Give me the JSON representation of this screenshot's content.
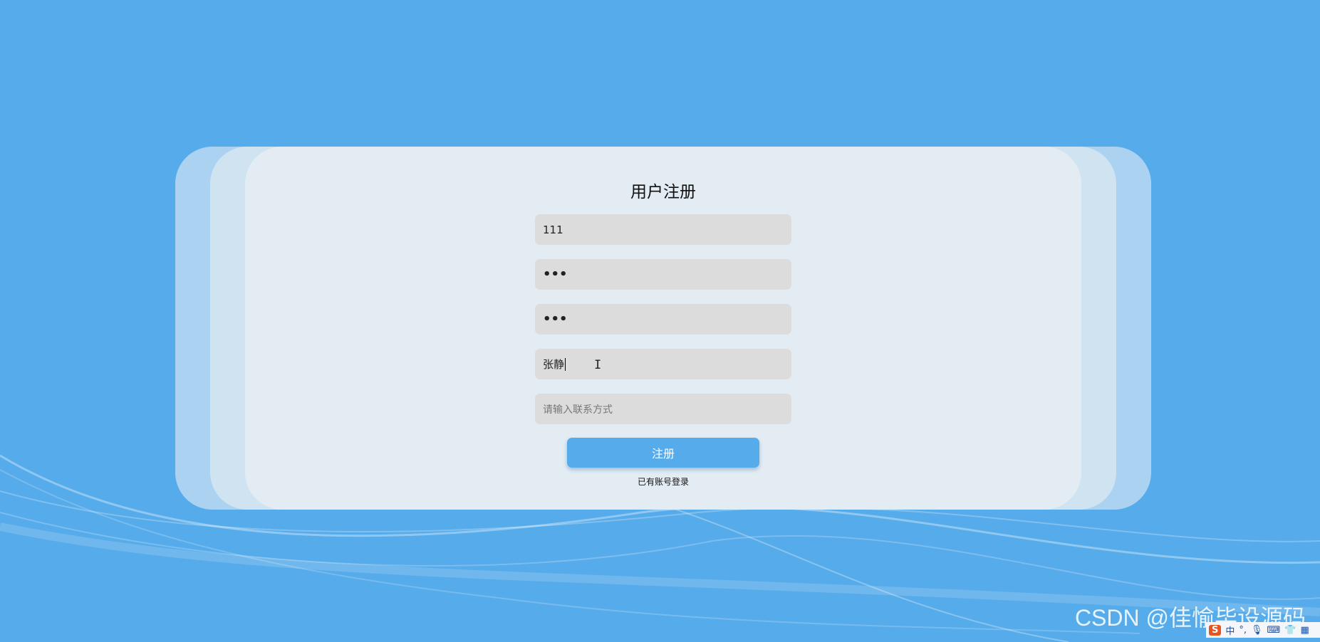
{
  "form": {
    "title": "用户注册",
    "username_value": "111",
    "password_value": "•••",
    "confirm_password_value": "•••",
    "name_value": "张静",
    "contact_placeholder": "请输入联系方式",
    "submit_label": "注册",
    "login_link": "已有账号登录"
  },
  "watermark": "CSDN @佳愉毕设源码",
  "ime": {
    "logo": "S",
    "mode": "中",
    "icons": [
      "punctuation-icon",
      "microphone-icon",
      "keyboard-icon",
      "skin-icon",
      "grid-icon"
    ]
  },
  "colors": {
    "background": "#56abea",
    "card": "#e3ecf3",
    "input": "#dcdcdc",
    "button": "#56abea"
  }
}
